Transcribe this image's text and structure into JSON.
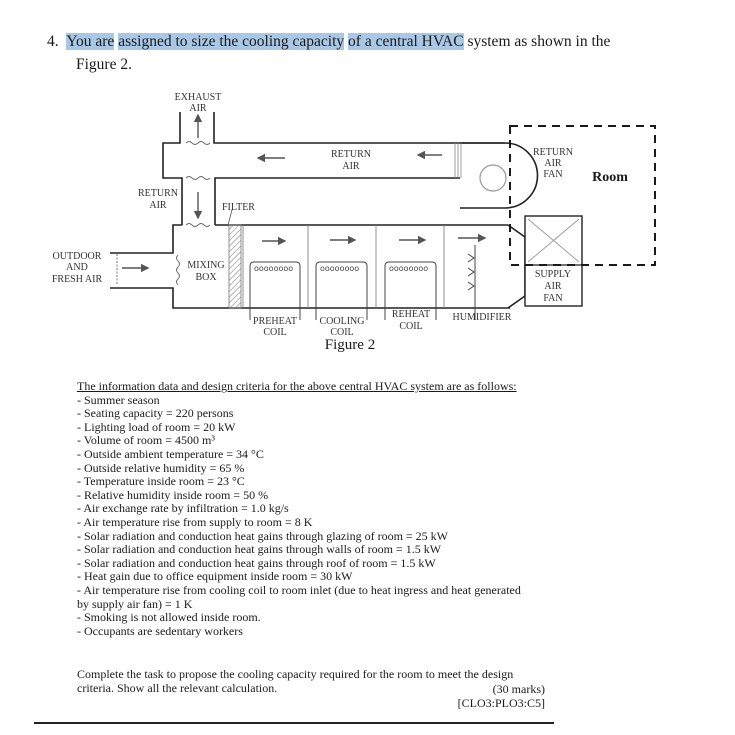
{
  "question": {
    "number": "4.",
    "text_parts": [
      {
        "text": "You are",
        "highlighted": true
      },
      {
        "text": " ",
        "highlighted": false
      },
      {
        "text": "assigned to size the cooling capacity",
        "highlighted": true
      },
      {
        "text": " ",
        "highlighted": false
      },
      {
        "text": "of a central HVAC",
        "highlighted": true
      },
      {
        "text": " system as shown in the",
        "highlighted": false
      }
    ],
    "line2": "Figure 2.",
    "highlight_color": "#a9c8e6"
  },
  "figure": {
    "caption": "Figure 2",
    "labels": {
      "exhaust_air_1": "EXHAUST",
      "exhaust_air_2": "AIR",
      "return_air_left_1": "RETURN",
      "return_air_left_2": "AIR",
      "return_air_top_1": "RETURN",
      "return_air_top_2": "AIR",
      "filter": "FILTER",
      "outdoor_1": "OUTDOOR",
      "outdoor_2": "AND",
      "outdoor_3": "FRESH AIR",
      "mixing_1": "MIXING",
      "mixing_2": "BOX",
      "preheat_1": "PREHEAT",
      "preheat_2": "COIL",
      "cooling_1": "COOLING",
      "cooling_2": "COIL",
      "reheat_1": "REHEAT",
      "reheat_2": "COIL",
      "humidifier": "HUMIDIFIER",
      "return_fan_1": "RETURN",
      "return_fan_2": "AIR",
      "return_fan_3": "FAN",
      "supply_fan_1": "SUPPLY",
      "supply_fan_2": "AIR",
      "supply_fan_3": "FAN",
      "room": "Room"
    }
  },
  "info": {
    "heading": "The information data and design criteria for the above central HVAC system are as follows:",
    "items": [
      "- Summer season",
      "- Seating capacity = 220 persons",
      "- Lighting load of room = 20 kW",
      "- Volume of room = 4500 m³",
      "- Outside ambient temperature = 34 °C",
      "- Outside relative humidity = 65 %",
      "- Temperature inside room = 23 °C",
      "- Relative humidity inside room = 50 %",
      "- Air exchange rate by infiltration = 1.0 kg/s",
      "- Air temperature rise from supply to room = 8 K",
      "- Solar radiation and conduction heat gains through glazing of room = 25 kW",
      "- Solar radiation and conduction heat gains through walls of room = 1.5 kW",
      "- Solar radiation and conduction heat gains through roof of room = 1.5 kW",
      "- Heat gain due to office equipment inside room = 30 kW",
      "- Air temperature rise from cooling coil to room inlet (due to heat ingress and heat generated",
      "by supply air fan) = 1 K",
      "- Smoking is not allowed inside room.",
      "- Occupants are sedentary workers"
    ]
  },
  "task": {
    "text": "Complete the task to propose the cooling capacity required for the room to meet the design criteria. Show all the relevant calculation.",
    "marks": "(30 marks)",
    "outcomes": "[CLO3:PLO3:C5]"
  }
}
